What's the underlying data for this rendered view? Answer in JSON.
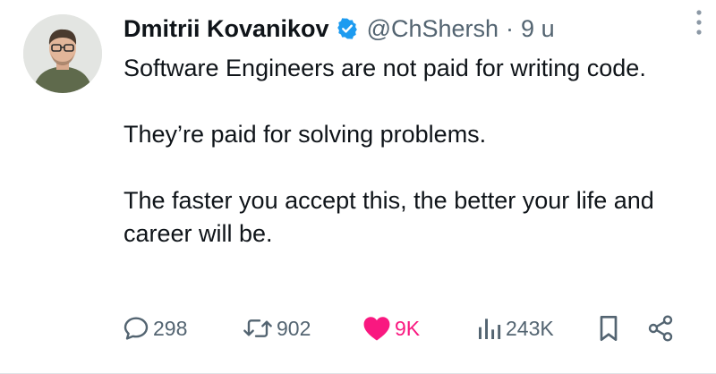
{
  "author": {
    "name": "Dmitrii Kovanikov",
    "handle": "@ChShersh",
    "separator": "·",
    "time": "9 u"
  },
  "tweet": {
    "paragraphs": [
      "Software Engineers are not paid for writing code.",
      "They’re paid for solving problems.",
      "The faster you accept this, the better your life and career will be."
    ]
  },
  "actions": {
    "replies": "298",
    "retweets": "902",
    "likes": "9K",
    "views": "243K"
  },
  "icons": {
    "verified": "verified-badge-icon",
    "more": "more-options-icon",
    "reply": "reply-icon",
    "retweet": "retweet-icon",
    "like": "heart-icon",
    "views": "views-icon",
    "bookmark": "bookmark-icon",
    "share": "share-icon"
  },
  "colors": {
    "text": "#0f1419",
    "muted": "#536471",
    "verified": "#1d9bf0",
    "like": "#f91880"
  }
}
